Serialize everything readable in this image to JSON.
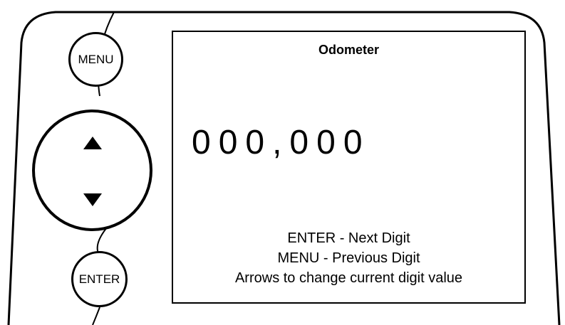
{
  "device": {
    "buttons": {
      "menu_label": "MENU",
      "enter_label": "ENTER",
      "up_icon": "triangle-up",
      "down_icon": "triangle-down"
    }
  },
  "screen": {
    "title": "Odometer",
    "odometer_value": "000,000",
    "instructions": [
      "ENTER - Next Digit",
      "MENU - Previous Digit",
      "Arrows to change current digit value"
    ]
  },
  "colors": {
    "outline": "#000000",
    "background": "#ffffff"
  }
}
